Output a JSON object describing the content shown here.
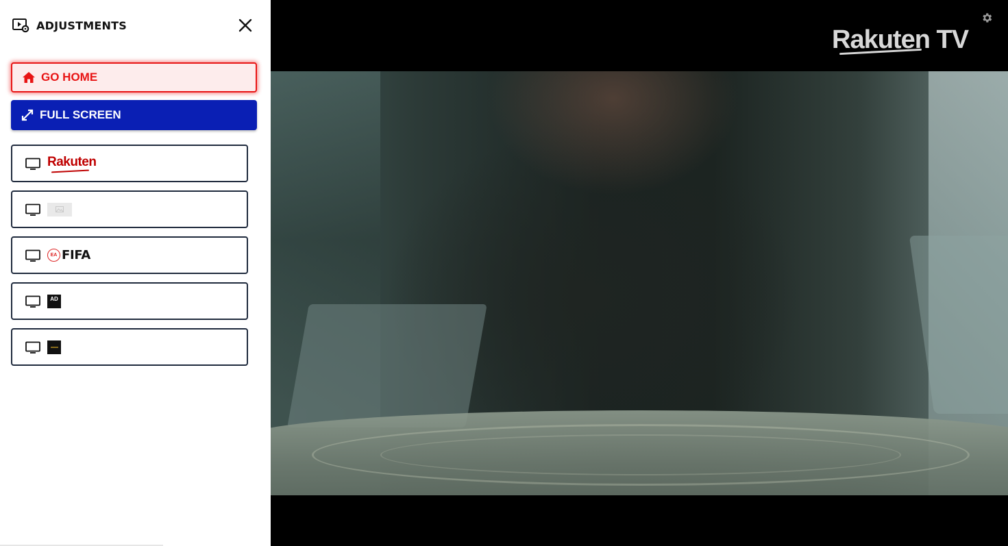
{
  "panel": {
    "title": "ADJUSTMENTS",
    "icons": {
      "header": "video-settings-icon",
      "close": "close-icon"
    }
  },
  "buttons": {
    "home": {
      "label": "GO HOME",
      "icon": "home-icon",
      "color": "#e81414"
    },
    "fullscreen": {
      "label": "FULL SCREEN",
      "icon": "expand-icon",
      "color": "#0a1fb4"
    }
  },
  "channels": [
    {
      "logo_text": "Rakuten",
      "logo_color": "#bf0000",
      "icon": "tv-icon"
    },
    {
      "logo_text": "",
      "icon": "tv-icon"
    },
    {
      "logo_text": "FIFA",
      "badge_text": "EA",
      "icon": "tv-icon"
    },
    {
      "logo_text": "AD",
      "icon": "tv-icon"
    },
    {
      "logo_text": "",
      "icon": "tv-icon"
    }
  ],
  "player": {
    "brand": "Rakuten TV",
    "settings_icon": "gear-icon"
  }
}
